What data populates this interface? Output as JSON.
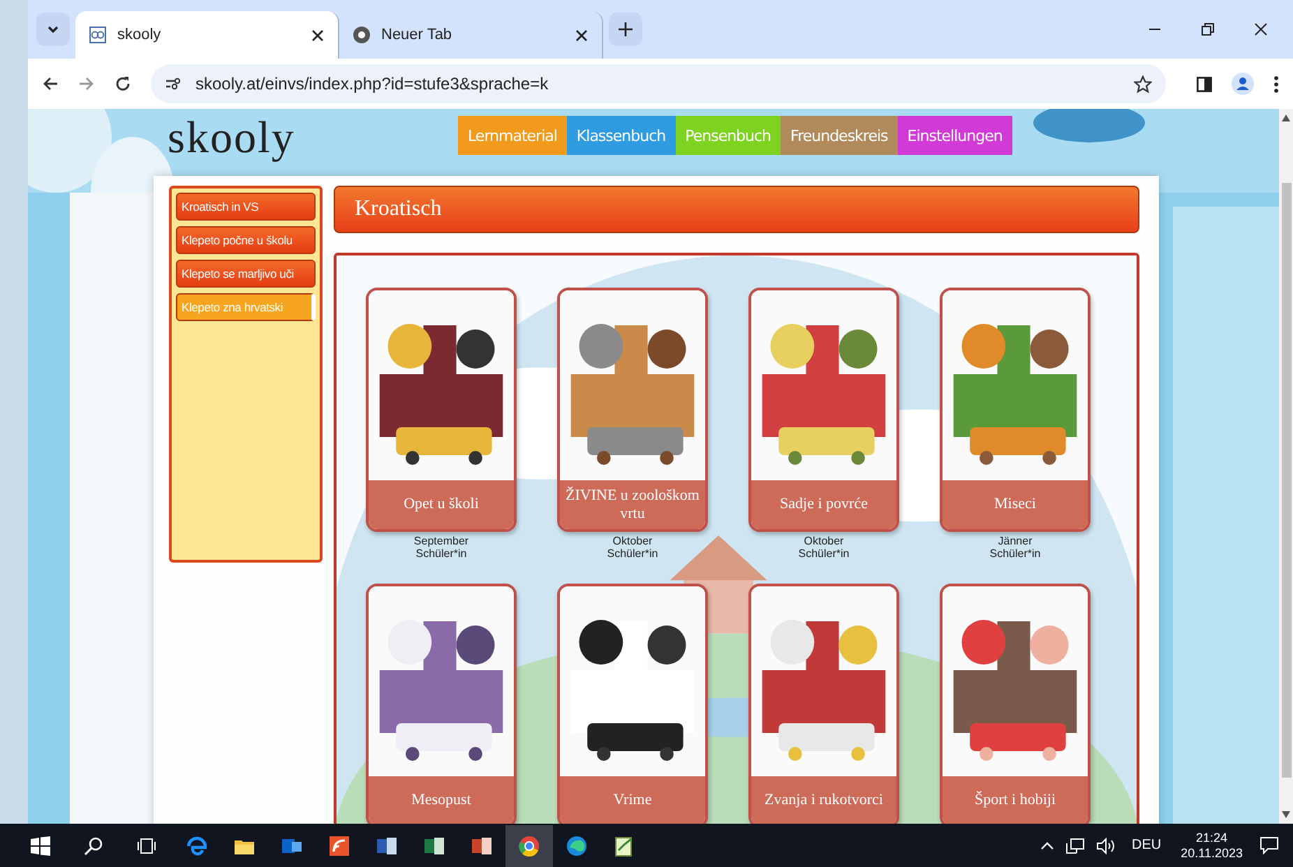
{
  "browser": {
    "tabs": [
      {
        "title": "skooly",
        "selected": true
      },
      {
        "title": "Neuer Tab",
        "selected": false
      }
    ],
    "address": "skooly.at/einvs/index.php?id=stufe3&sprache=k"
  },
  "site": {
    "logo": "skooly",
    "nav": [
      {
        "label": "Lernmaterial",
        "color": "#f29a1c"
      },
      {
        "label": "Klassenbuch",
        "color": "#2f9be0"
      },
      {
        "label": "Pensenbuch",
        "color": "#7ed321"
      },
      {
        "label": "Freundeskreis",
        "color": "#b08a5a"
      },
      {
        "label": "Einstellungen",
        "color": "#d23ad8"
      }
    ],
    "sidebar": [
      {
        "label": "Kroatisch in VS",
        "selected": false
      },
      {
        "label": "Klepeto počne u školu",
        "selected": false
      },
      {
        "label": "Klepeto se marljivo uči",
        "selected": false
      },
      {
        "label": "Klepeto zna hrvatski",
        "selected": true
      }
    ],
    "heading": "Kroatisch",
    "cards": [
      {
        "title": "Opet u školi",
        "month": "September",
        "audience": "Schüler*in"
      },
      {
        "title": "ŽIVINE u zoološkom vrtu",
        "month": "Oktober",
        "audience": "Schüler*in"
      },
      {
        "title": "Sadje i povrće",
        "month": "Oktober",
        "audience": "Schüler*in"
      },
      {
        "title": "Miseci",
        "month": "Jänner",
        "audience": "Schüler*in"
      },
      {
        "title": "Mesopust"
      },
      {
        "title": "Vrime"
      },
      {
        "title": "Zvanja i rukotvorci"
      },
      {
        "title": "Šport i hobiji"
      }
    ]
  },
  "taskbar": {
    "language": "DEU",
    "time": "21:24",
    "date": "20.11.2023"
  }
}
